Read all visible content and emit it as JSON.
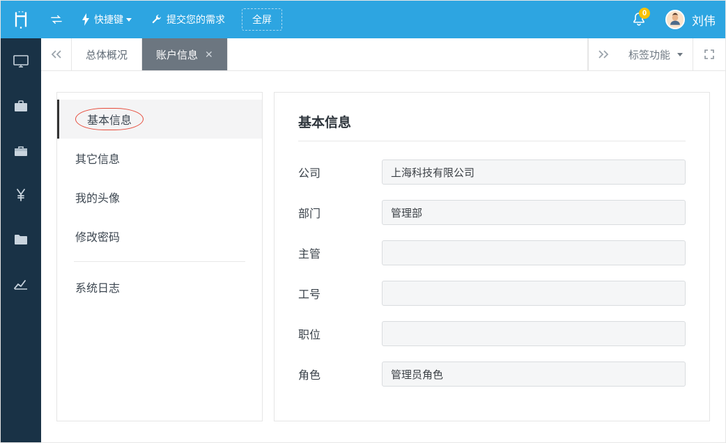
{
  "topbar": {
    "shortcut_label": "快捷键",
    "submit_demand_label": "提交您的需求",
    "fullscreen_label": "全屏",
    "notif_count": "0",
    "username": "刘伟"
  },
  "tabs": {
    "overview": "总体概况",
    "account_info": "账户信息",
    "tab_functions": "标签功能"
  },
  "sidebar": {
    "items": [
      {
        "label": "基本信息"
      },
      {
        "label": "其它信息"
      },
      {
        "label": "我的头像"
      },
      {
        "label": "修改密码"
      },
      {
        "label": "系统日志"
      }
    ]
  },
  "form": {
    "title": "基本信息",
    "fields": {
      "company": {
        "label": "公司",
        "value": "上海科技有限公司"
      },
      "department": {
        "label": "部门",
        "value": "管理部"
      },
      "manager": {
        "label": "主管",
        "value": ""
      },
      "employee_no": {
        "label": "工号",
        "value": ""
      },
      "position": {
        "label": "职位",
        "value": ""
      },
      "role": {
        "label": "角色",
        "value": "管理员角色"
      }
    }
  }
}
